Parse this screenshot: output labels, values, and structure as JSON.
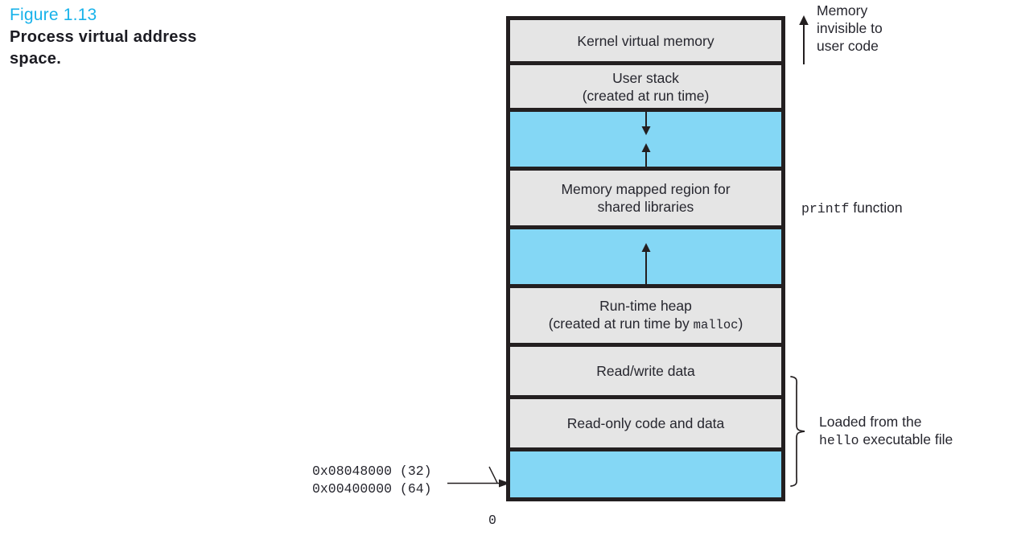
{
  "caption": {
    "figure_number": "Figure 1.13",
    "title_line1": "Process virtual address",
    "title_line2": "space.",
    "accent_color": "#17B2EA"
  },
  "colors": {
    "box_fill": "#E5E5E5",
    "gap_fill": "#84D7F5",
    "stroke": "#231F20",
    "text": "#26262E"
  },
  "diagram": {
    "name": "process-virtual-address-space",
    "regions": [
      {
        "id": "kernel-virtual-memory",
        "label_line1": "Kernel virtual memory",
        "label_line2": "",
        "fill": "gray",
        "arrow": "none"
      },
      {
        "id": "user-stack",
        "label_line1": "User stack",
        "label_line2": "(created at run time)",
        "fill": "gray",
        "arrow": "none"
      },
      {
        "id": "stack-mmap-gap",
        "label_line1": "",
        "label_line2": "",
        "fill": "blue",
        "arrow": "down-and-up"
      },
      {
        "id": "memory-mapped-region",
        "label_line1": "Memory mapped region for",
        "label_line2": "shared libraries",
        "fill": "gray",
        "arrow": "none"
      },
      {
        "id": "mmap-heap-gap",
        "label_line1": "",
        "label_line2": "",
        "fill": "blue",
        "arrow": "up"
      },
      {
        "id": "run-time-heap",
        "label_line1": "Run-time heap",
        "label_line2_pre": "(created at run time by ",
        "label_line2_mono": "malloc",
        "label_line2_post": ")",
        "fill": "gray",
        "arrow": "none"
      },
      {
        "id": "read-write-data",
        "label_line1": "Read/write data",
        "label_line2": "",
        "fill": "gray",
        "arrow": "none"
      },
      {
        "id": "read-only-code-and-data",
        "label_line1": "Read-only code and data",
        "label_line2": "",
        "fill": "gray",
        "arrow": "none"
      },
      {
        "id": "unmapped-low-memory",
        "label_line1": "",
        "label_line2": "",
        "fill": "blue",
        "arrow": "none"
      }
    ]
  },
  "annotations": {
    "kernel": {
      "line1": "Memory",
      "line2": "invisible to",
      "line3": "user code"
    },
    "printf": {
      "mono": "printf",
      "rest": " function"
    },
    "loaded": {
      "line1": "Loaded from the",
      "line2_mono": "hello",
      "line2_rest": " executable file"
    }
  },
  "addresses": {
    "line1": "0x08048000 (32)",
    "line2": "0x00400000 (64)",
    "zero": "0"
  }
}
